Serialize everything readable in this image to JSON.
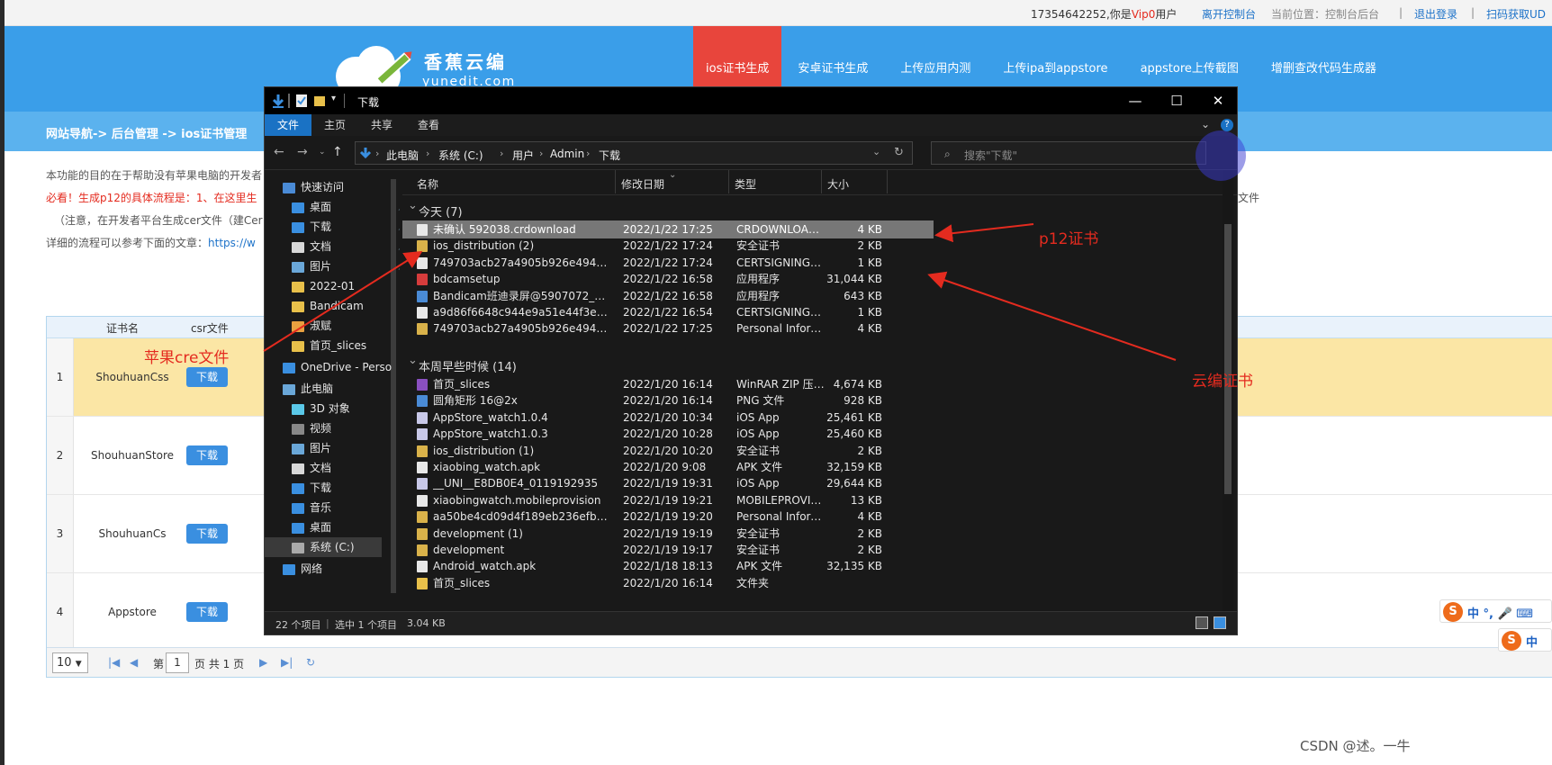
{
  "topbar": {
    "phone": "17354642252",
    "greeting_pre": ",你是",
    "vip": "Vip0",
    "greeting_post": "用户",
    "leave": "离开控制台",
    "location": "当前位置：控制台后台",
    "sep": "|",
    "logout": "退出登录",
    "scan": "扫码获取UD"
  },
  "logo": {
    "name": "香蕉云编",
    "sub": "yunedit.com"
  },
  "nav": {
    "items": [
      "ios证书生成",
      "安卓证书生成",
      "上传应用内测",
      "上传ipa到appstore",
      "appstore上传截图",
      "增删查改代码生成器"
    ]
  },
  "crumb": "网站导航-> 后台管理 -> ios证书管理",
  "desc": {
    "line1": "本功能的目的在于帮助没有苹果电脑的开发者",
    "line2_red": "必看！生成p12的具体流程是",
    "line2": "：1、在这里生",
    "line2_tail": "文件",
    "line3": "（注意，在开发者平台生成cer文件（建Cer",
    "line4": "详细的流程可以参考下面的文章：",
    "line4_link": "https://w"
  },
  "table": {
    "headers": [
      "证书名",
      "csr文件"
    ],
    "download": "下载",
    "rows": [
      {
        "no": "1",
        "name": "ShouhuanCss"
      },
      {
        "no": "2",
        "name": "ShouhuanStore"
      },
      {
        "no": "3",
        "name": "ShouhuanCs"
      },
      {
        "no": "4",
        "name": "Appstore"
      }
    ],
    "pager": {
      "size": "10",
      "page_label": "第",
      "page": "1",
      "of": "页 共 1 页"
    }
  },
  "explorer": {
    "title": "下载",
    "ribbon": [
      "文件",
      "主页",
      "共享",
      "查看"
    ],
    "path": [
      "此电脑",
      "系统 (C:)",
      "用户",
      "Admin",
      "下载"
    ],
    "search": "搜索\"下载\"",
    "columns": [
      "名称",
      "修改日期",
      "类型",
      "大小"
    ],
    "groups": [
      {
        "label": "今天 (7)"
      },
      {
        "label": "本周早些时候 (14)"
      }
    ],
    "today": [
      {
        "name": "未确认 592038.crdownload",
        "date": "2022/1/22 17:25",
        "type": "CRDOWNLOAD ...",
        "size": "4 KB",
        "color": "#e8e8e8"
      },
      {
        "name": "ios_distribution (2)",
        "date": "2022/1/22 17:24",
        "type": "安全证书",
        "size": "2 KB",
        "color": "#d9b24a"
      },
      {
        "name": "749703acb27a4905b926e4946daa8e...",
        "date": "2022/1/22 17:24",
        "type": "CERTSIGNINGR...",
        "size": "1 KB",
        "color": "#e8e8e8"
      },
      {
        "name": "bdcamsetup",
        "date": "2022/1/22 16:58",
        "type": "应用程序",
        "size": "31,044 KB",
        "color": "#d63c3c"
      },
      {
        "name": "Bandicam班迪录屏@5907072_434158",
        "date": "2022/1/22 16:58",
        "type": "应用程序",
        "size": "643 KB",
        "color": "#4a8bd6"
      },
      {
        "name": "a9d86f6648c944e9a51e44f3ea97aaac...",
        "date": "2022/1/22 16:54",
        "type": "CERTSIGNINGR...",
        "size": "1 KB",
        "color": "#e8e8e8"
      },
      {
        "name": "749703acb27a4905b926e4946daa8e55",
        "date": "2022/1/22 17:25",
        "type": "Personal Inform...",
        "size": "4 KB",
        "color": "#d9b24a"
      }
    ],
    "week": [
      {
        "name": "首页_slices",
        "date": "2022/1/20 16:14",
        "type": "WinRAR ZIP 压缩...",
        "size": "4,674 KB",
        "color": "#8a4fc0"
      },
      {
        "name": "圆角矩形 16@2x",
        "date": "2022/1/20 16:14",
        "type": "PNG 文件",
        "size": "928 KB",
        "color": "#4a8bd6"
      },
      {
        "name": "AppStore_watch1.0.4",
        "date": "2022/1/20 10:34",
        "type": "iOS App",
        "size": "25,461 KB",
        "color": "#c8c8e8"
      },
      {
        "name": "AppStore_watch1.0.3",
        "date": "2022/1/20 10:28",
        "type": "iOS App",
        "size": "25,460 KB",
        "color": "#c8c8e8"
      },
      {
        "name": "ios_distribution (1)",
        "date": "2022/1/20 10:20",
        "type": "安全证书",
        "size": "2 KB",
        "color": "#d9b24a"
      },
      {
        "name": "xiaobing_watch.apk",
        "date": "2022/1/20 9:08",
        "type": "APK 文件",
        "size": "32,159 KB",
        "color": "#e8e8e8"
      },
      {
        "name": "__UNI__E8DB0E4_0119192935",
        "date": "2022/1/19 19:31",
        "type": "iOS App",
        "size": "29,644 KB",
        "color": "#c8c8e8"
      },
      {
        "name": "xiaobingwatch.mobileprovision",
        "date": "2022/1/19 19:21",
        "type": "MOBILEPROVISI...",
        "size": "13 KB",
        "color": "#e8e8e8"
      },
      {
        "name": "aa50be4cd09d4f189eb236efb48870ec",
        "date": "2022/1/19 19:20",
        "type": "Personal Inform...",
        "size": "4 KB",
        "color": "#d9b24a"
      },
      {
        "name": "development (1)",
        "date": "2022/1/19 19:19",
        "type": "安全证书",
        "size": "2 KB",
        "color": "#d9b24a"
      },
      {
        "name": "development",
        "date": "2022/1/19 19:17",
        "type": "安全证书",
        "size": "2 KB",
        "color": "#d9b24a"
      },
      {
        "name": "Android_watch.apk",
        "date": "2022/1/18 18:13",
        "type": "APK 文件",
        "size": "32,135 KB",
        "color": "#e8e8e8"
      },
      {
        "name": "首页_slices",
        "date": "2022/1/20 16:14",
        "type": "文件夹",
        "size": "",
        "color": "#e8c04a"
      }
    ],
    "nav": [
      {
        "label": "快速访问",
        "color": "#4a8bd6",
        "pin": false
      },
      {
        "label": "桌面",
        "color": "#3a8fe0",
        "pin": true
      },
      {
        "label": "下载",
        "color": "#3a8fe0",
        "pin": true
      },
      {
        "label": "文档",
        "color": "#d8d8d8",
        "pin": true
      },
      {
        "label": "图片",
        "color": "#6aa7d8",
        "pin": true
      },
      {
        "label": "2022-01",
        "color": "#e8c04a",
        "pin": false
      },
      {
        "label": "Bandicam",
        "color": "#e8c04a",
        "pin": false
      },
      {
        "label": "淑赋",
        "color": "#e8a040",
        "pin": false
      },
      {
        "label": "首页_slices",
        "color": "#e8c04a",
        "pin": false
      },
      {
        "label": "OneDrive - Perso",
        "color": "#3a8fe0",
        "pin": false
      },
      {
        "label": "此电脑",
        "color": "#6aa7d8",
        "pin": false
      },
      {
        "label": "3D 对象",
        "color": "#5ac8e8",
        "pin": false
      },
      {
        "label": "视频",
        "color": "#888",
        "pin": false
      },
      {
        "label": "图片",
        "color": "#6aa7d8",
        "pin": false
      },
      {
        "label": "文档",
        "color": "#d8d8d8",
        "pin": false
      },
      {
        "label": "下载",
        "color": "#3a8fe0",
        "pin": false
      },
      {
        "label": "音乐",
        "color": "#3a8fe0",
        "pin": false
      },
      {
        "label": "桌面",
        "color": "#3a8fe0",
        "pin": false
      },
      {
        "label": "系统 (C:)",
        "color": "#aaa",
        "pin": false
      },
      {
        "label": "网络",
        "color": "#3a8fe0",
        "pin": false
      }
    ],
    "status": {
      "count": "22 个项目",
      "sep": "|",
      "selected": "选中 1 个项目",
      "size": "3.04 KB"
    }
  },
  "annotations": {
    "p12": "p12证书",
    "cre": "苹果cre文件",
    "yunbian": "云编证书"
  },
  "ime": {
    "s": "S",
    "t1": "中 °, 🎤 ⌨",
    "t2": "中"
  },
  "watermark": "CSDN @述。一牛"
}
